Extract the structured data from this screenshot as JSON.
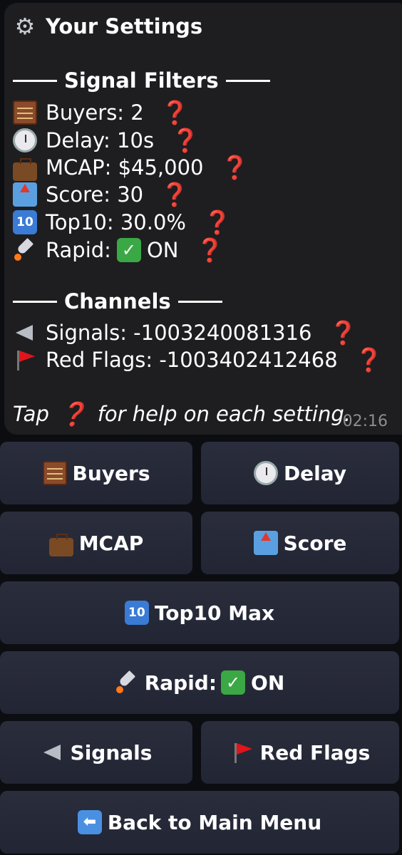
{
  "message": {
    "title": "Your Settings",
    "section_filters": "Signal Filters",
    "buyers": "Buyers: 2",
    "delay": "Delay: 10s",
    "mcap": "MCAP: $45,000",
    "score": "Score: 30",
    "top10": "Top10: 30.0%",
    "rapid_label": "Rapid:",
    "rapid_state": "ON",
    "section_channels": "Channels",
    "signals": "Signals: -1003240081316",
    "red_flags": "Red Flags: -1003402412468",
    "help_prefix": "Tap",
    "help_suffix": "for help on each setting.",
    "help_glyph": "❓",
    "time": "02:16"
  },
  "keyboard": {
    "buyers": "Buyers",
    "delay": "Delay",
    "mcap": "MCAP",
    "score": "Score",
    "top10_max": "Top10 Max",
    "rapid_label": "Rapid:",
    "rapid_state": "ON",
    "signals": "Signals",
    "red_flags": "Red Flags",
    "back": "Back to Main Menu"
  },
  "icons": {
    "settings": "gear-icon",
    "buyers": "abacus-icon",
    "delay": "stopwatch-icon",
    "mcap": "briefcase-icon",
    "score": "outbox-tray-icon",
    "top10": "keycap-ten-icon",
    "rapid": "rocket-icon",
    "check": "check-mark-icon",
    "signals": "loudspeaker-icon",
    "red_flags": "red-flag-icon",
    "back": "left-arrow-icon",
    "help": "question-mark-icon"
  },
  "colors": {
    "background": "#0b0d11",
    "bubble": "#1e1e20",
    "button": "#262938",
    "help_red": "#e0151b",
    "check_green": "#3aa845",
    "timestamp": "#8d8d91"
  }
}
